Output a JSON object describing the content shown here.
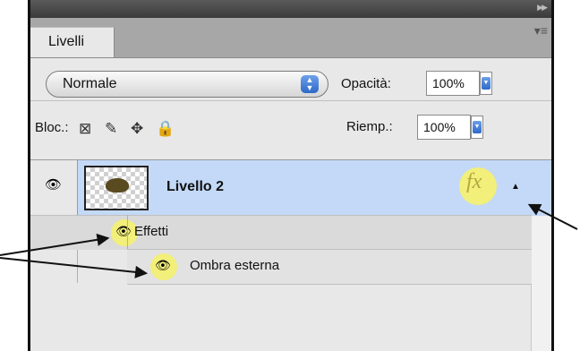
{
  "panel": {
    "tab_label": "Livelli",
    "blend_mode": "Normale",
    "opacity_label": "Opacità:",
    "opacity_value": "100%",
    "lock_label": "Bloc.:",
    "fill_label": "Riemp.:",
    "fill_value": "100%"
  },
  "layers": {
    "layer_name": "Livello 2",
    "fx_label": "fx",
    "effects_label": "Effetti",
    "effect_item": "Ombra esterna"
  },
  "icons": {
    "eye": "eye-icon",
    "transparency_lock": "checkerboard-lock-icon",
    "brush_lock": "brush-icon",
    "move_lock": "move-icon",
    "all_lock": "padlock-icon",
    "menu": "panel-menu-icon"
  },
  "colors": {
    "selected_row": "#c3d9f7",
    "highlight": "#f2ef7a",
    "accent": "#2d69c8"
  }
}
